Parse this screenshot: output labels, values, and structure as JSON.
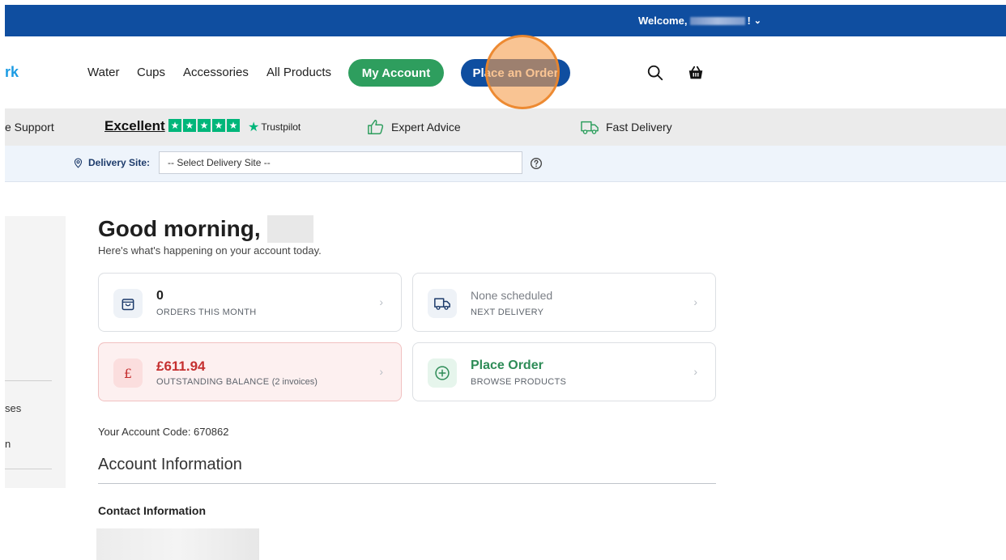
{
  "topbar": {
    "welcome_prefix": "Welcome,",
    "welcome_suffix": "!",
    "chevron": "⌄"
  },
  "nav": {
    "logo_fragment": "rk",
    "links": [
      "Water",
      "Cups",
      "Accessories",
      "All Products"
    ],
    "my_account_label": "My Account",
    "place_order_label": "Place an Order",
    "icons": [
      "search-icon",
      "basket-icon"
    ]
  },
  "trustbar": {
    "support_label": "e Support",
    "excellent_label": "Excellent",
    "trustpilot_label": "Trustpilot",
    "expert_label": "Expert Advice",
    "fast_label": "Fast Delivery",
    "rating_stars": 5
  },
  "delivery": {
    "label": "Delivery Site:",
    "select_value": "-- Select Delivery Site --"
  },
  "sidebar": {
    "items": [
      "ses",
      "n"
    ]
  },
  "main": {
    "greeting": "Good morning,",
    "subtitle": "Here's what's happening on your account today.",
    "cards": [
      {
        "value": "0",
        "label": "ORDERS THIS MONTH"
      },
      {
        "value": "None scheduled",
        "label": "NEXT DELIVERY"
      },
      {
        "value": "£611.94",
        "label": "OUTSTANDING BALANCE",
        "label_extra": "(2 invoices)"
      },
      {
        "value": "Place Order",
        "label": "BROWSE PRODUCTS"
      }
    ],
    "account_code": "Your Account Code: 670862",
    "account_info_title": "Account Information",
    "contact_title": "Contact Information"
  },
  "colors": {
    "primary_blue": "#0f4ea0",
    "green": "#2e9e5e",
    "red": "#c53030",
    "trustpilot_green": "#00b67a"
  }
}
